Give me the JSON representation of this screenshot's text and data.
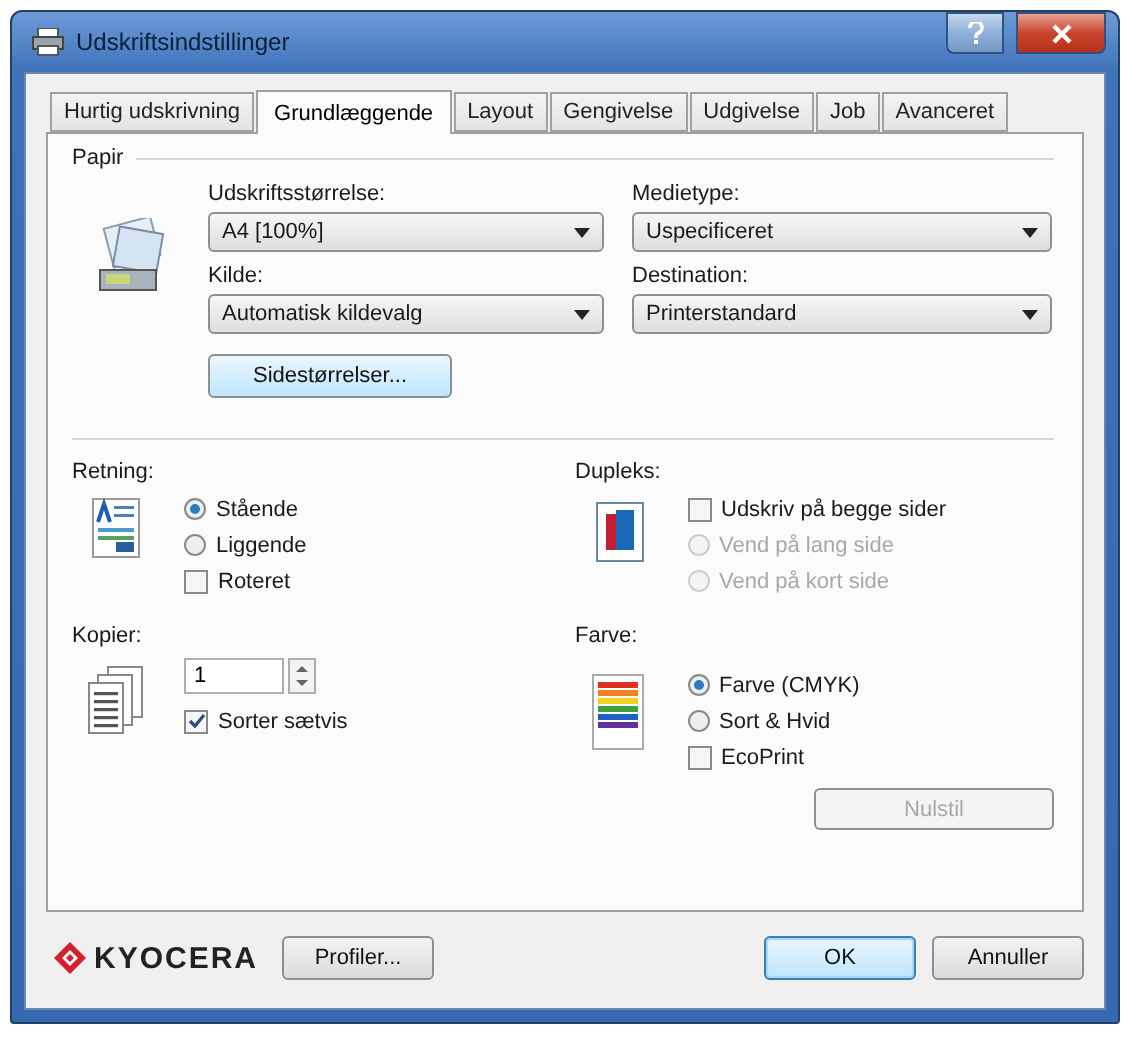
{
  "window": {
    "title": "Udskriftsindstillinger"
  },
  "tabs": [
    {
      "label": "Hurtig udskrivning",
      "selected": false
    },
    {
      "label": "Grundlæggende",
      "selected": true
    },
    {
      "label": "Layout",
      "selected": false
    },
    {
      "label": "Gengivelse",
      "selected": false
    },
    {
      "label": "Udgivelse",
      "selected": false
    },
    {
      "label": "Job",
      "selected": false
    },
    {
      "label": "Avanceret",
      "selected": false
    }
  ],
  "paper": {
    "legend": "Papir",
    "fields": [
      {
        "label": "Udskriftsstørrelse:",
        "value": "A4 [100%]"
      },
      {
        "label": "Medietype:",
        "value": "Uspecificeret"
      },
      {
        "label": "Kilde:",
        "value": "Automatisk kildevalg"
      },
      {
        "label": "Destination:",
        "value": "Printerstandard"
      }
    ],
    "button": "Sidestørrelser..."
  },
  "orientation": {
    "label": "Retning:",
    "options": [
      {
        "label": "Stående",
        "selected": true,
        "disabled": false
      },
      {
        "label": "Liggende",
        "selected": false,
        "disabled": false
      }
    ],
    "rotated": {
      "label": "Roteret",
      "checked": false
    }
  },
  "copies": {
    "label": "Kopier:",
    "value": "1",
    "collate": {
      "label": "Sorter sætvis",
      "checked": true
    }
  },
  "duplex": {
    "label": "Dupleks:",
    "print_both": {
      "label": "Udskriv på begge sider",
      "checked": false
    },
    "options": [
      {
        "label": "Vend på lang side",
        "selected": false,
        "disabled": true
      },
      {
        "label": "Vend på kort side",
        "selected": false,
        "disabled": true
      }
    ]
  },
  "color": {
    "label": "Farve:",
    "options": [
      {
        "label": "Farve (CMYK)",
        "selected": true,
        "disabled": false
      },
      {
        "label": "Sort & Hvid",
        "selected": false,
        "disabled": false
      }
    ],
    "ecoprint": {
      "label": "EcoPrint",
      "checked": false
    }
  },
  "reset_button": {
    "label": "Nulstil",
    "disabled": true
  },
  "footer": {
    "logo": "KYOCERA",
    "profiles_button": "Profiler...",
    "buttons": [
      {
        "label": "OK",
        "default": true
      },
      {
        "label": "Annuller",
        "default": false
      }
    ]
  }
}
